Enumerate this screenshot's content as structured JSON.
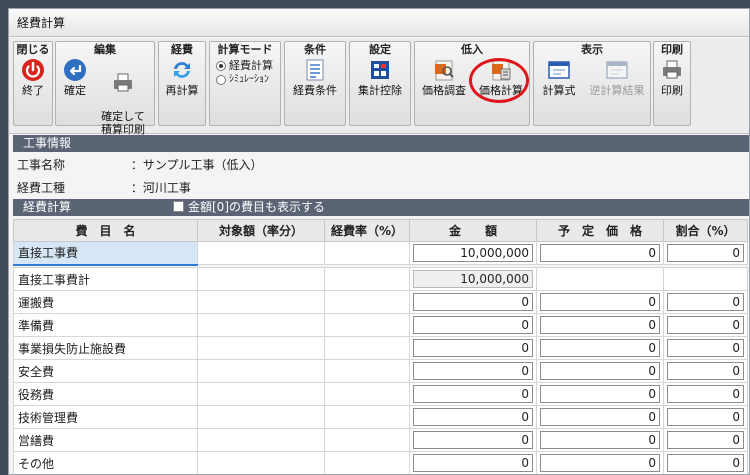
{
  "window": {
    "title": "経費計算"
  },
  "ribbon": {
    "groups": [
      {
        "title": "閉じる",
        "buttons": [
          {
            "label": "終了",
            "icon": "power-icon"
          }
        ]
      },
      {
        "title": "編集",
        "buttons": [
          {
            "label": "確定",
            "icon": "confirm-icon"
          },
          {
            "label": "確定して\n積算印刷",
            "icon": "printer-icon"
          }
        ]
      },
      {
        "title": "経費",
        "buttons": [
          {
            "label": "再計算",
            "icon": "recalc-icon"
          }
        ]
      },
      {
        "title": "計算モード",
        "options": [
          {
            "label": "経費計算",
            "selected": true
          },
          {
            "label": "ｼﾐｭﾚｰｼｮﾝ",
            "selected": false
          }
        ]
      },
      {
        "title": "条件",
        "buttons": [
          {
            "label": "経費条件",
            "icon": "list-icon"
          }
        ]
      },
      {
        "title": "設定",
        "buttons": [
          {
            "label": "集計控除",
            "icon": "calc-book-icon"
          }
        ]
      },
      {
        "title": "低入",
        "buttons": [
          {
            "label": "価格調査",
            "icon": "price-survey-icon"
          },
          {
            "label": "価格計算",
            "icon": "price-calc-icon"
          }
        ]
      },
      {
        "title": "表示",
        "buttons": [
          {
            "label": "計算式",
            "icon": "formula-window-icon"
          },
          {
            "label": "逆計算結果",
            "icon": "reverse-calc-icon",
            "disabled": true
          }
        ]
      },
      {
        "title": "印刷",
        "buttons": [
          {
            "label": "印刷",
            "icon": "printer-icon"
          }
        ]
      }
    ]
  },
  "project_info": {
    "header": "工事情報",
    "rows": [
      {
        "label": "工事名称",
        "value": "：サンプル工事（低入）"
      },
      {
        "label": "経費工種",
        "value": "：河川工事"
      }
    ]
  },
  "expense": {
    "header": "経費計算",
    "show_zero_label": "金額[0]の費目も表示する",
    "columns": [
      "費　目　名",
      "対象額（率分）",
      "経費率（%）",
      "金　　額",
      "予　定　価　格",
      "割合（%）"
    ],
    "rows": [
      {
        "name": "直接工事費",
        "amount": "10,000,000",
        "planned": "0",
        "ratio": "0",
        "selected": true
      },
      {
        "name": "直接工事費計",
        "amount": "10,000,000",
        "readonly": true
      },
      {
        "name": "運搬費",
        "amount": "0",
        "planned": "0",
        "ratio": "0"
      },
      {
        "name": "準備費",
        "amount": "0",
        "planned": "0",
        "ratio": "0"
      },
      {
        "name": "事業損失防止施設費",
        "amount": "0",
        "planned": "0",
        "ratio": "0"
      },
      {
        "name": "安全費",
        "amount": "0",
        "planned": "0",
        "ratio": "0"
      },
      {
        "name": "役務費",
        "amount": "0",
        "planned": "0",
        "ratio": "0"
      },
      {
        "name": "技術管理費",
        "amount": "0",
        "planned": "0",
        "ratio": "0"
      },
      {
        "name": "営繕費",
        "amount": "0",
        "planned": "0",
        "ratio": "0"
      },
      {
        "name": "その他",
        "amount": "0",
        "planned": "0",
        "ratio": "0"
      }
    ]
  },
  "colors": {
    "section_header": "#5a6474",
    "highlight_circle": "#e0151c",
    "selected_row": "#2f7bd6"
  }
}
